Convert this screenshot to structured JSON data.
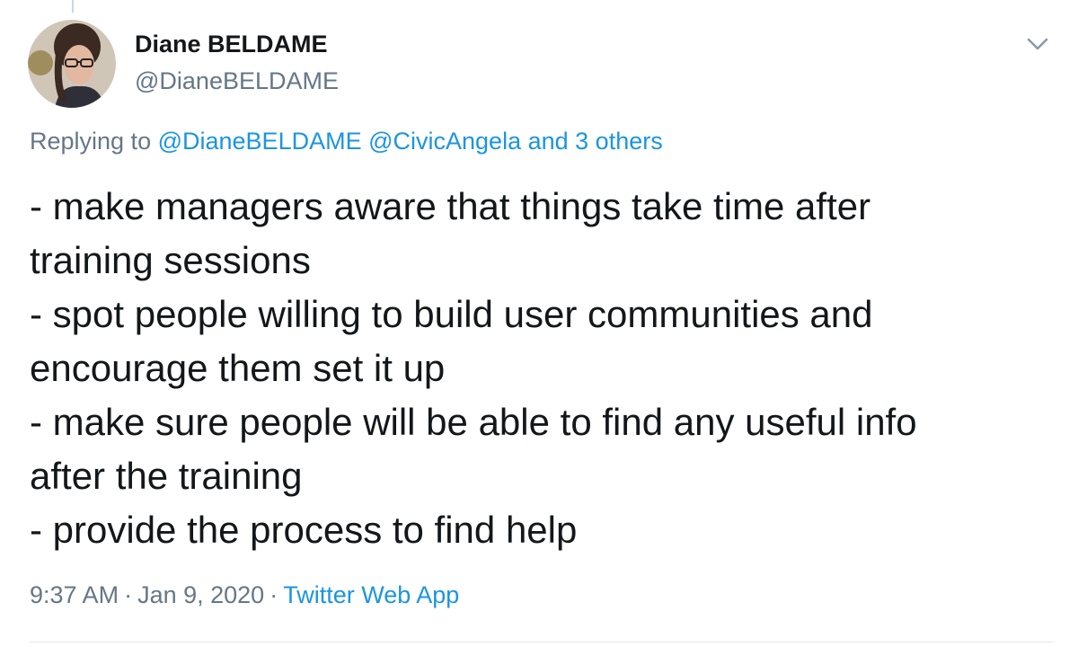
{
  "author": {
    "display_name": "Diane BELDAME",
    "handle": "@DianeBELDAME",
    "avatar_icon": "profile-photo"
  },
  "reply": {
    "prefix": "Replying to ",
    "mention_1": "@DianeBELDAME",
    "mention_2": "@CivicAngela",
    "others": "and 3 others"
  },
  "tweet": {
    "lines": [
      "- make managers aware that things take time after",
      "training sessions",
      "- spot people willing to build user communities and",
      "encourage them set it up",
      "- make sure people will be able to find any useful info",
      "after the training",
      "- provide the process to find help"
    ]
  },
  "meta": {
    "time": "9:37 AM",
    "separator": "·",
    "date": "Jan 9, 2020",
    "source": "Twitter Web App"
  },
  "colors": {
    "link": "#1b95e0",
    "secondary_text": "#657786",
    "primary_text": "#14171a"
  },
  "icons": {
    "menu": "chevron-down-icon"
  }
}
